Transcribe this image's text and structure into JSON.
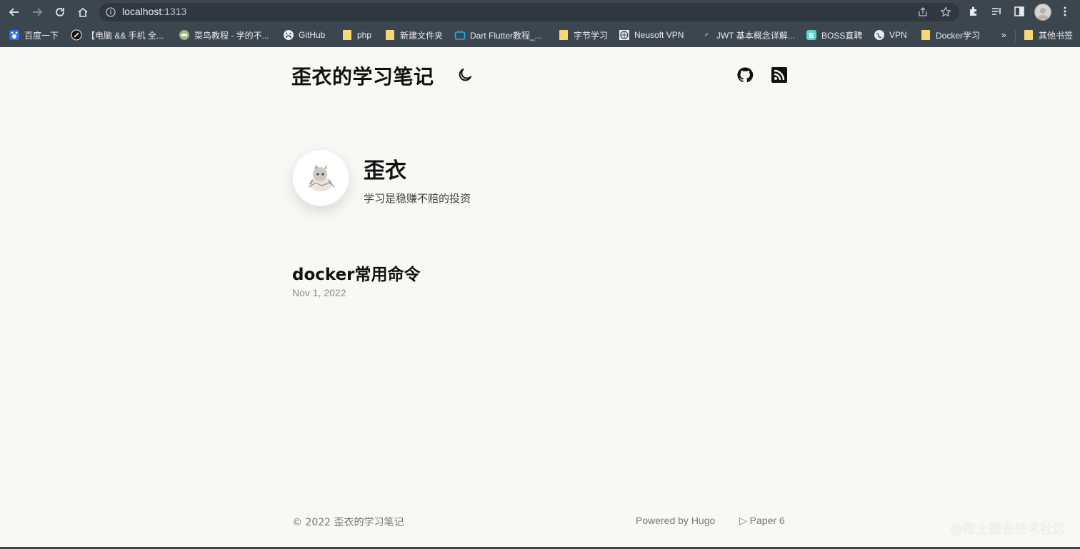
{
  "browser": {
    "url_host": "localhost",
    "url_port": ":1313",
    "bookmarks": [
      {
        "label": "百度一下",
        "icon": "baidu-icon"
      },
      {
        "label": "【电脑 && 手机 全...",
        "icon": "site-icon"
      },
      {
        "label": "菜鸟教程 - 学的不...",
        "icon": "runoob-icon"
      },
      {
        "label": "GitHub",
        "icon": "github-icon"
      },
      {
        "label": "php",
        "icon": "folder-icon"
      },
      {
        "label": "新建文件夹",
        "icon": "folder-icon"
      },
      {
        "label": "Dart Flutter教程_...",
        "icon": "bilibili-icon"
      },
      {
        "label": "字节学习",
        "icon": "folder-icon"
      },
      {
        "label": "Neusoft VPN",
        "icon": "globe-icon"
      },
      {
        "label": "JWT 基本概念详解...",
        "icon": "site-icon"
      },
      {
        "label": "BOSS直聘",
        "icon": "boss-icon"
      },
      {
        "label": "VPN",
        "icon": "globe-icon"
      },
      {
        "label": "Docker学习",
        "icon": "folder-icon"
      }
    ],
    "overflow_label": "»",
    "other_bookmarks": "其他书签"
  },
  "site": {
    "title": "歪衣的学习笔记"
  },
  "profile": {
    "name": "歪衣",
    "bio": "学习是稳赚不赔的投资"
  },
  "posts": [
    {
      "title": "docker常用命令",
      "date": "Nov 1, 2022"
    }
  ],
  "footer": {
    "copyright": "© 2022 歪衣的学习笔记",
    "powered": "Powered by Hugo",
    "theme": "▷ Paper 6"
  },
  "watermark": "@稀土掘金技术社区"
}
